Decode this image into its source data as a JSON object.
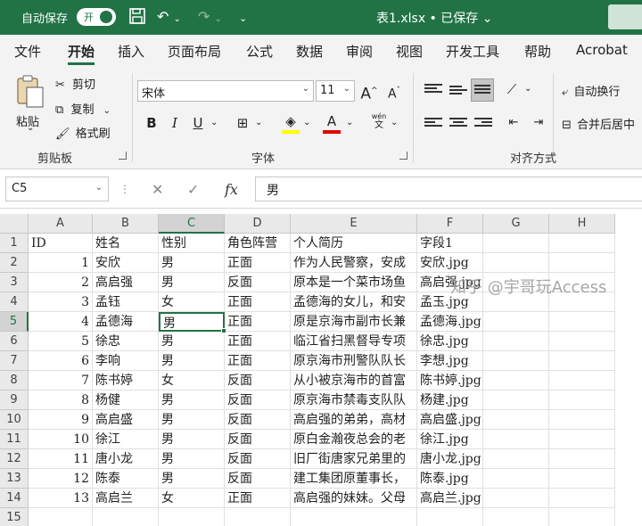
{
  "titlebar": {
    "autosave_label": "自动保存",
    "autosave_state": "开",
    "title": "表1.xlsx • 已保存 ⌄"
  },
  "tabs": [
    "文件",
    "开始",
    "插入",
    "页面布局",
    "公式",
    "数据",
    "审阅",
    "视图",
    "开发工具",
    "帮助",
    "Acrobat"
  ],
  "active_tab": "开始",
  "ribbon": {
    "clipboard": {
      "paste": "粘贴",
      "cut": "剪切",
      "copy": "复制",
      "format_painter": "格式刷",
      "group": "剪贴板"
    },
    "font": {
      "name": "宋体",
      "size": "11",
      "bold": "B",
      "italic": "I",
      "underline": "U",
      "font_color_sample": "A",
      "pinyin_top": "wén",
      "pinyin_bottom": "文",
      "grow": "A",
      "shrink": "A",
      "group": "字体"
    },
    "alignment": {
      "wrap_text": "自动换行",
      "merge_center": "合并后居中",
      "group": "对齐方式"
    },
    "colors": {
      "fill_yellow": "#ffff00",
      "font_red": "#e00000"
    }
  },
  "formula_bar": {
    "name_box": "C5",
    "fx": "fx",
    "value": "男"
  },
  "grid": {
    "columns": [
      "A",
      "B",
      "C",
      "D",
      "E",
      "F",
      "G",
      "H"
    ],
    "selected_column": "C",
    "selected_row": 5,
    "rows": [
      {
        "n": "1",
        "A": "ID",
        "B": "姓名",
        "C": "性别",
        "D": "角色阵营",
        "E": "个人简历",
        "F": "字段1"
      },
      {
        "n": "2",
        "A": "1",
        "B": "安欣",
        "C": "男",
        "D": "正面",
        "E": "作为人民警察，安成",
        "F": "安欣.jpg"
      },
      {
        "n": "3",
        "A": "2",
        "B": "高启强",
        "C": "男",
        "D": "反面",
        "E": "原本是一个菜市场鱼",
        "F": "高启强.jpg"
      },
      {
        "n": "4",
        "A": "3",
        "B": "孟钰",
        "C": "女",
        "D": "正面",
        "E": "孟德海的女儿，和安",
        "F": "孟玉.jpg"
      },
      {
        "n": "5",
        "A": "4",
        "B": "孟德海",
        "C": "男",
        "D": "正面",
        "E": "原是京海市副市长兼",
        "F": "孟德海.jpg"
      },
      {
        "n": "6",
        "A": "5",
        "B": "徐忠",
        "C": "男",
        "D": "正面",
        "E": "临江省扫黑督导专项",
        "F": "徐忠.jpg"
      },
      {
        "n": "7",
        "A": "6",
        "B": "李响",
        "C": "男",
        "D": "正面",
        "E": "原京海市刑警队队长",
        "F": "李想.jpg"
      },
      {
        "n": "8",
        "A": "7",
        "B": "陈书婷",
        "C": "女",
        "D": "反面",
        "E": "从小被京海市的首富",
        "F": "陈书婷.jpg"
      },
      {
        "n": "9",
        "A": "8",
        "B": "杨健",
        "C": "男",
        "D": "反面",
        "E": "原京海市禁毒支队队",
        "F": "杨建.jpg"
      },
      {
        "n": "10",
        "A": "9",
        "B": "高启盛",
        "C": "男",
        "D": "反面",
        "E": "高启强的弟弟，高材",
        "F": "高启盛.jpg"
      },
      {
        "n": "11",
        "A": "10",
        "B": "徐江",
        "C": "男",
        "D": "反面",
        "E": "原白金瀚夜总会的老",
        "F": "徐江.jpg"
      },
      {
        "n": "12",
        "A": "11",
        "B": "唐小龙",
        "C": "男",
        "D": "反面",
        "E": "旧厂街唐家兄弟里的",
        "F": "唐小龙.jpg"
      },
      {
        "n": "13",
        "A": "12",
        "B": "陈泰",
        "C": "男",
        "D": "反面",
        "E": "建工集团原董事长，",
        "F": "陈泰.jpg"
      },
      {
        "n": "14",
        "A": "13",
        "B": "高启兰",
        "C": "女",
        "D": "正面",
        "E": "高启强的妹妹。父母",
        "F": "高启兰.jpg"
      },
      {
        "n": "15",
        "A": "",
        "B": "",
        "C": "",
        "D": "",
        "E": "",
        "F": ""
      }
    ]
  },
  "watermark": "知乎 @宇哥玩Access"
}
